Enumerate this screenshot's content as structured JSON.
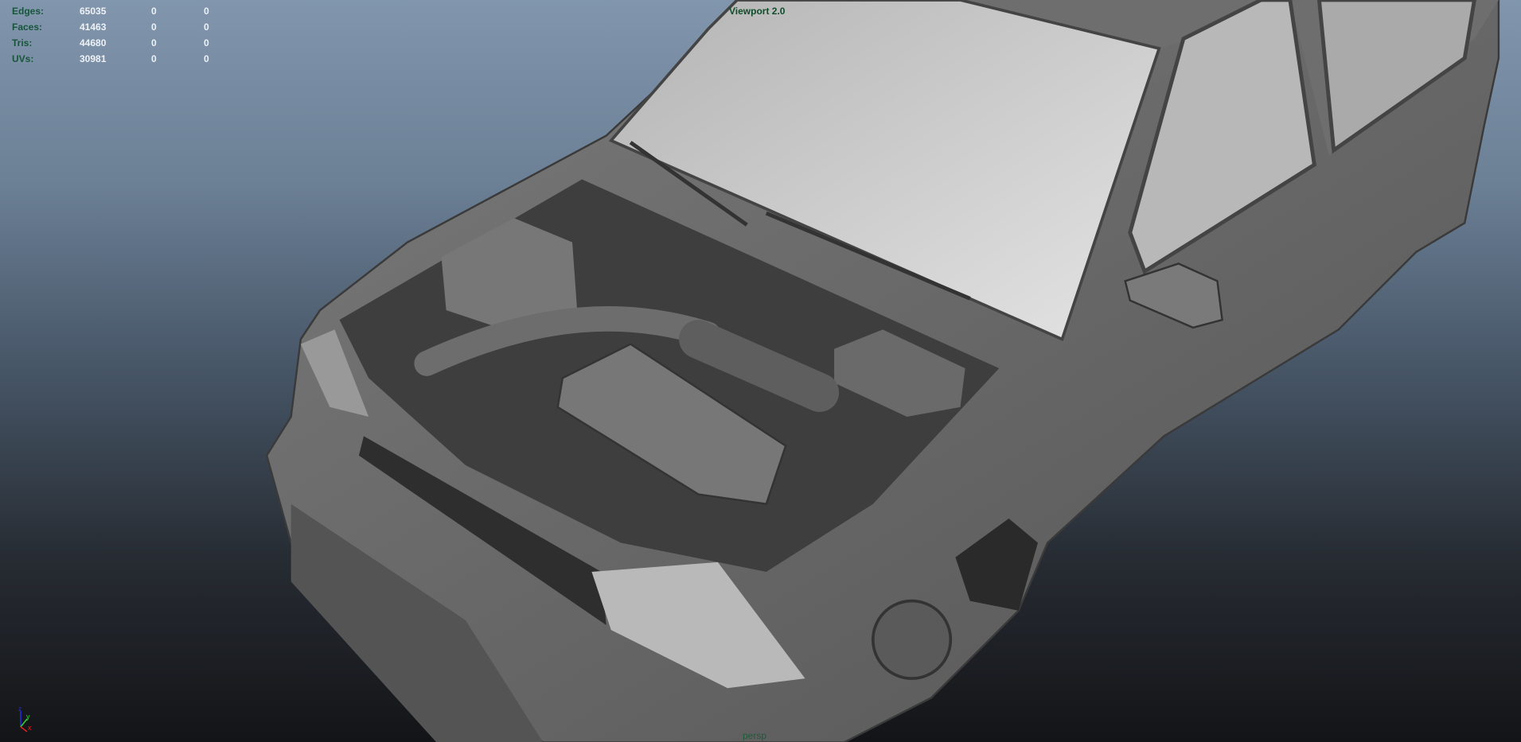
{
  "viewport": {
    "renderer_label": "Viewport 2.0",
    "camera_label": "persp"
  },
  "hud_stats": [
    {
      "label": "Edges:",
      "values": [
        "65035",
        "0",
        "0"
      ]
    },
    {
      "label": "Faces:",
      "values": [
        "41463",
        "0",
        "0"
      ]
    },
    {
      "label": "Tris:",
      "values": [
        "44680",
        "0",
        "0"
      ]
    },
    {
      "label": "UVs:",
      "values": [
        "30981",
        "0",
        "0"
      ]
    }
  ],
  "axis_gizmo": {
    "z": "z",
    "y": "y",
    "x": "x"
  },
  "colors": {
    "hud_label": "#17553a",
    "axis_x": "#e02020",
    "axis_y": "#30d030",
    "axis_z": "#2030e0"
  }
}
